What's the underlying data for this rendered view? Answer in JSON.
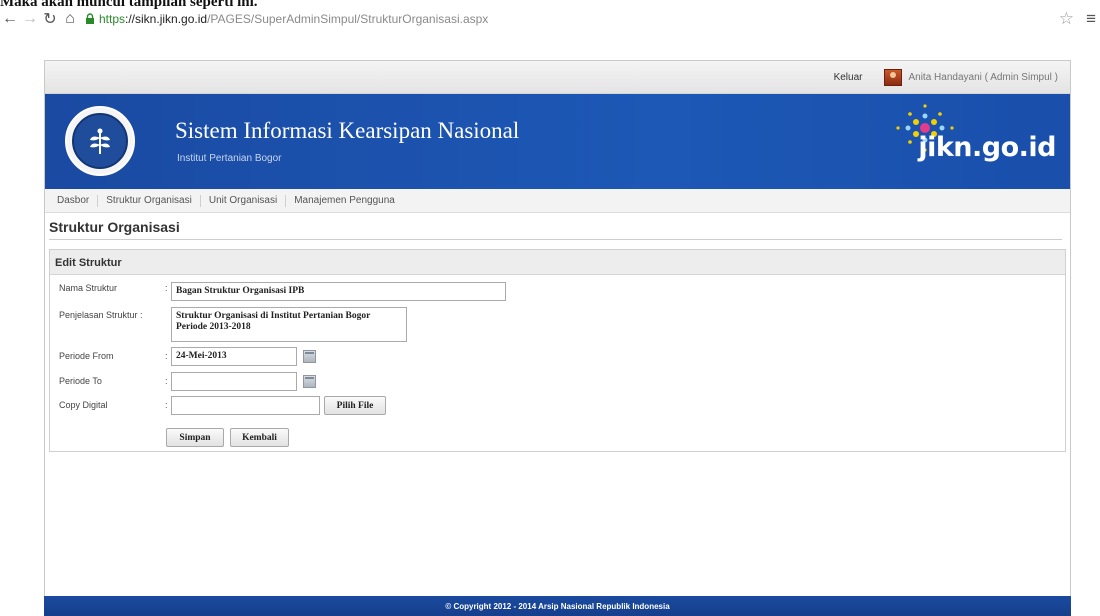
{
  "caption": "Maka akan muncul tampilan seperti ini.",
  "browser": {
    "url_scheme": "https",
    "url_host": "://sikn.jikn.go.id",
    "url_path": "/PAGES/SuperAdminSimpul/StrukturOrganisasi.aspx"
  },
  "topbar": {
    "logout_label": "Keluar",
    "user_label": "Anita Handayani ( Admin Simpul )"
  },
  "header": {
    "title": "Sistem Informasi Kearsipan Nasional",
    "subtitle": "Institut Pertanian Bogor",
    "brand": "jikn.go.id"
  },
  "nav": {
    "items": [
      {
        "label": "Dasbor"
      },
      {
        "label": "Struktur Organisasi"
      },
      {
        "label": "Unit Organisasi"
      },
      {
        "label": "Manajemen Pengguna"
      }
    ]
  },
  "page": {
    "title": "Struktur Organisasi"
  },
  "form": {
    "panel_title": "Edit Struktur",
    "colon": ":",
    "nama": {
      "label": "Nama Struktur",
      "value": "Bagan Struktur Organisasi IPB"
    },
    "penjelasan": {
      "label": "Penjelasan Struktur :",
      "value": "Struktur Organisasi di Institut Pertanian Bogor Periode 2013-2018"
    },
    "periode_from": {
      "label": "Periode From",
      "value": "24-Mei-2013"
    },
    "periode_to": {
      "label": "Periode To",
      "value": ""
    },
    "copy_digital": {
      "label": "Copy Digital",
      "value": "",
      "button_label": "Pilih File"
    },
    "save_label": "Simpan",
    "back_label": "Kembali"
  },
  "footer": {
    "text": "© Copyright 2012 - 2014 Arsip Nasional Republik Indonesia"
  },
  "colors": {
    "banner_blue": "#1d58b6",
    "footer_blue": "#1a4aa0",
    "url_scheme_green": "#2a8a2a"
  }
}
